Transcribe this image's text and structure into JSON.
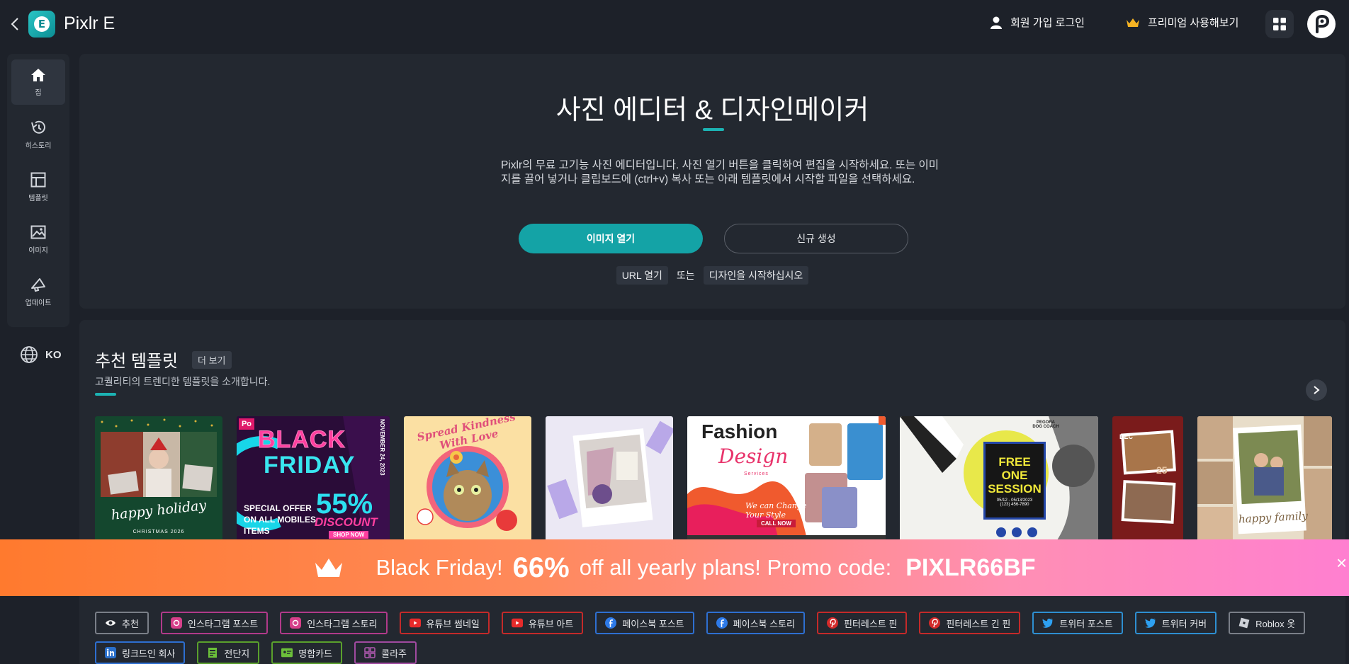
{
  "header": {
    "app_title": "Pixlr E",
    "logo_letter": "E",
    "login_label": "회원 가입 로그인",
    "premium_label": "프리미엄 사용해보기"
  },
  "sidebar": {
    "items": [
      {
        "label": "집",
        "icon": "home-icon"
      },
      {
        "label": "히스토리",
        "icon": "history-icon"
      },
      {
        "label": "템플릿",
        "icon": "template-icon"
      },
      {
        "label": "이미지",
        "icon": "image-icon"
      },
      {
        "label": "업데이트",
        "icon": "megaphone-icon"
      }
    ],
    "language": "KO"
  },
  "hero": {
    "title": "사진 에디터 & 디자인메이커",
    "description": "Pixlr의 무료 고기능 사진 에디터입니다. 사진 열기 버튼을 클릭하여 편집을 시작하세요. 또는 이미지를 끌어 넣거나 클립보드에 (ctrl+v) 복사 또는 아래 템플릿에서 시작할 파일을 선택하세요.",
    "open_image": "이미지 열기",
    "create_new": "신규 생성",
    "url_open": "URL 열기",
    "or": "또는",
    "start_design": "디자인을 시작하십시오"
  },
  "templates": {
    "title": "추천 템플릿",
    "more": "더 보기",
    "subtitle": "고퀄리티의 트렌디한 템플릿을 소개합니다.",
    "thumb_texts": {
      "christmas_1": "happy holiday",
      "christmas_2": "CHRISTMAS 2026",
      "bf_brand": "Po",
      "bf_1": "BLACK",
      "bf_2": "FRIDAY",
      "bf_3": "SPECIAL OFFER",
      "bf_4": "ON ALL MOBILES",
      "bf_5": "ITEMS",
      "bf_6": "55%",
      "bf_7": "DISCOUNT",
      "bf_8": "SHOP NOW",
      "bf_9": "NOVEMBER 24, 2023",
      "cat_1": "Spread Kindness With Love",
      "fashion_1": "Fashion",
      "fashion_2": "Design",
      "fashion_3": "Services",
      "fashion_4": "We can Change",
      "fashion_5": "Your Style",
      "fashion_6": "CALL NOW",
      "dog_1": "FREE",
      "dog_2": "ONE",
      "dog_3": "SESSION",
      "dog_4": "05/12 - 05/13/2023",
      "dog_5": "(123) 456-7890",
      "dog_6": "PEGORA DOG COACH",
      "dec_1": "DEC",
      "dec_2": "25",
      "family_1": "happy family"
    }
  },
  "promo": {
    "part1": "Black Friday!",
    "part2": "66%",
    "part3": "off all yearly plans! Promo code:",
    "code": "PIXLR66BF",
    "close": "×"
  },
  "categories": [
    {
      "label": "추천",
      "color": "#7a7f88",
      "icon": "eye-icon"
    },
    {
      "label": "인스타그램 포스트",
      "color": "#b13a8a",
      "icon": "instagram-icon"
    },
    {
      "label": "인스타그램 스토리",
      "color": "#b13a8a",
      "icon": "instagram-icon"
    },
    {
      "label": "유튜브 썸네일",
      "color": "#c42a2a",
      "icon": "youtube-icon"
    },
    {
      "label": "유튜브 아트",
      "color": "#c42a2a",
      "icon": "youtube-icon"
    },
    {
      "label": "페이스북 포스트",
      "color": "#2e6fd1",
      "icon": "facebook-icon"
    },
    {
      "label": "페이스북 스토리",
      "color": "#2e6fd1",
      "icon": "facebook-icon"
    },
    {
      "label": "핀터레스트 핀",
      "color": "#c42a2a",
      "icon": "pinterest-icon"
    },
    {
      "label": "핀터레스트 긴 핀",
      "color": "#c42a2a",
      "icon": "pinterest-icon"
    },
    {
      "label": "트위터 포스트",
      "color": "#2e8fd1",
      "icon": "twitter-icon"
    },
    {
      "label": "트위터 커버",
      "color": "#2e8fd1",
      "icon": "twitter-icon"
    },
    {
      "label": "Roblox 옷",
      "color": "#7a7f88",
      "icon": "roblox-icon"
    },
    {
      "label": "링크드인 회사",
      "color": "#2e6fd1",
      "icon": "linkedin-icon"
    },
    {
      "label": "전단지",
      "color": "#5aa02c",
      "icon": "flyer-icon"
    },
    {
      "label": "명함카드",
      "color": "#5aa02c",
      "icon": "card-icon"
    },
    {
      "label": "콜라주",
      "color": "#a04aa0",
      "icon": "collage-icon"
    }
  ],
  "colors": {
    "accent": "#14a3a6",
    "background": "#1d2129",
    "panel": "#232830"
  }
}
